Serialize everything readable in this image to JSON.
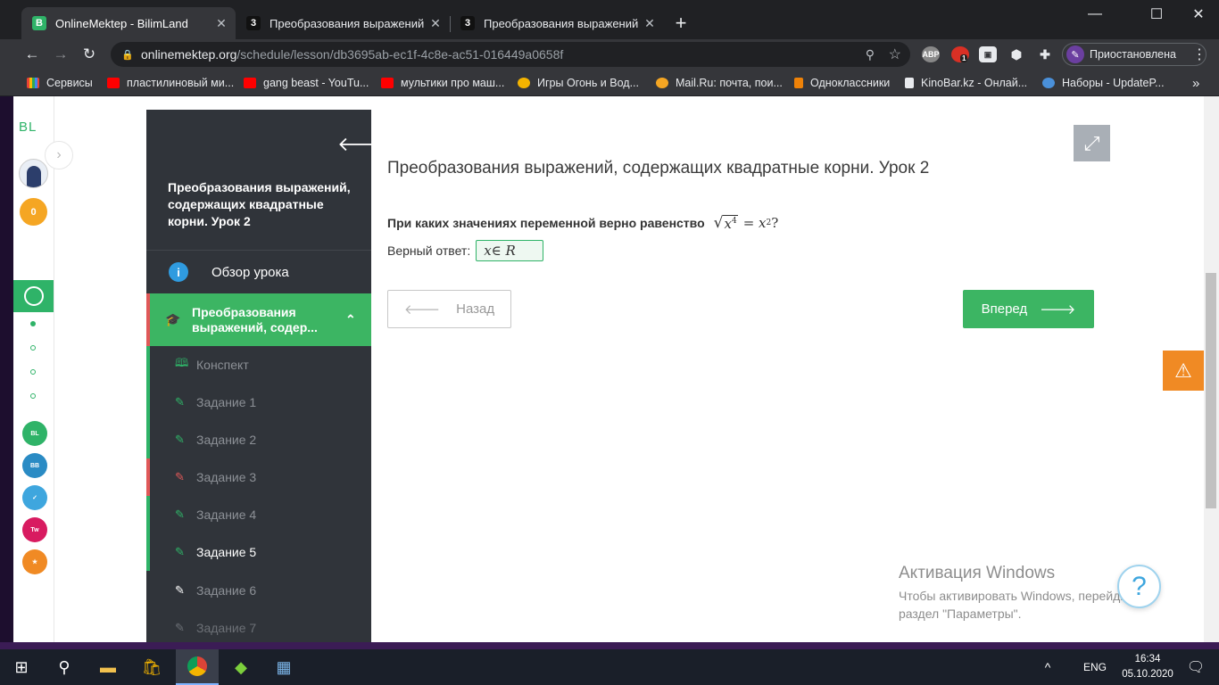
{
  "browser": {
    "tabs": [
      {
        "title": "OnlineMektep - BilimLand",
        "favicon": "B",
        "active": true
      },
      {
        "title": "Преобразования выражений, с",
        "favicon": "3",
        "active": false
      },
      {
        "title": "Преобразования выражений, с",
        "favicon": "3",
        "active": false
      }
    ],
    "new_tab": "+",
    "url_host": "onlinemektep.org",
    "url_path": "/schedule/lesson/db3695ab-ec1f-4c8e-ac51-016449a0658f",
    "profile_label": "Приостановлена",
    "extension_badge": "1",
    "bookmarks": [
      {
        "label": "Сервисы",
        "icon_color": "#ea4335"
      },
      {
        "label": "пластилиновый ми...",
        "icon_color": "#ff0000"
      },
      {
        "label": "gang beast - YouTu...",
        "icon_color": "#ff0000"
      },
      {
        "label": "мультики про маш...",
        "icon_color": "#ff0000"
      },
      {
        "label": "Игры Огонь и Вод...",
        "icon_color": "#f4b400"
      },
      {
        "label": "Mail.Ru: почта, пои...",
        "icon_color": "#f5a623"
      },
      {
        "label": "Одноклассники",
        "icon_color": "#ee8208"
      },
      {
        "label": "KinoBar.kz - Онлай...",
        "icon_color": "#222222"
      },
      {
        "label": "Наборы - UpdateP...",
        "icon_color": "#4a90d9"
      }
    ],
    "more_bookmarks": "»"
  },
  "rail": {
    "logo": "BL",
    "coins": "0"
  },
  "sidebar": {
    "lesson_title": "Преобразования выражений, содержащих квадратные корни. Урок 2",
    "overview_label": "Обзор урока",
    "section_label": "Преобразования выражений, содер...",
    "items": [
      {
        "label": "Конспект",
        "status_color": "#2fb368",
        "current": false
      },
      {
        "label": "Задание 1",
        "status_color": "#2fb368",
        "current": false
      },
      {
        "label": "Задание 2",
        "status_color": "#2fb368",
        "current": false
      },
      {
        "label": "Задание 3",
        "status_color": "#e05858",
        "current": false
      },
      {
        "label": "Задание 4",
        "status_color": "#2fb368",
        "current": false
      },
      {
        "label": "Задание 5",
        "status_color": "#2fb368",
        "current": true
      },
      {
        "label": "Задание 6",
        "status_color": "#30343a",
        "current": false
      },
      {
        "label": "Задание 7",
        "status_color": "#30343a",
        "current": false
      }
    ]
  },
  "content": {
    "title": "Преобразования выражений, содержащих квадратные корни. Урок 2",
    "question": "При каких значениях переменной верно равенство",
    "formula_radicand": "x",
    "formula_radicand_exp": "4",
    "formula_rhs": "= x",
    "formula_rhs_exp": "2",
    "formula_end": "?",
    "answer_label": "Верный ответ:",
    "answer_value": "x∈ R",
    "back_label": "Назад",
    "next_label": "Вперед"
  },
  "activation": {
    "title": "Активация Windows",
    "text": "Чтобы активировать Windows, перейдите в раздел \"Параметры\"."
  },
  "taskbar": {
    "language": "ENG",
    "time": "16:34",
    "date": "05.10.2020"
  },
  "colors": {
    "accent_green": "#3cb563",
    "sidebar_bg": "#30343a",
    "warning_orange": "#f08a24"
  }
}
